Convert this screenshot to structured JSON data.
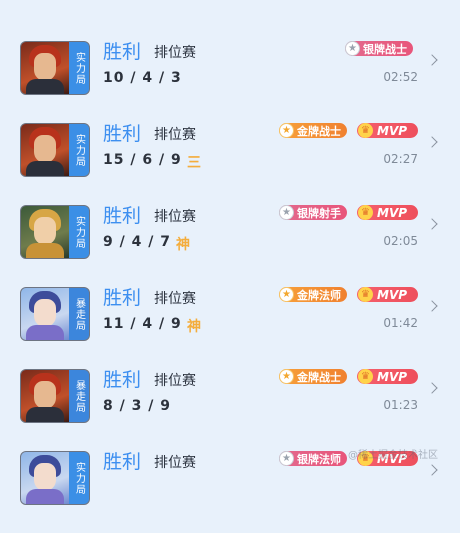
{
  "colors": {
    "result_win": "#3d8ff0",
    "tag_ranked": "#3b8fe6",
    "tag_rush": "#3c86dc",
    "badge_gold": "#f39a36",
    "badge_silver": "#e8587c",
    "mvp": "#f25a66",
    "honor_text": "#f4ad3c"
  },
  "matches": [
    {
      "result": "胜利",
      "match_type": "排位赛",
      "kda": "10 / 4 / 3",
      "honor": "",
      "badge": "银牌战士",
      "badge_tier": "silver",
      "mvp": "",
      "time": "02:52",
      "mode": "实力局",
      "hero_icon": "red-hair-warrior-portrait"
    },
    {
      "result": "胜利",
      "match_type": "排位赛",
      "kda": "15 / 6 / 9",
      "honor": "三",
      "badge": "金牌战士",
      "badge_tier": "gold",
      "mvp": "MVP",
      "time": "02:27",
      "mode": "实力局",
      "hero_icon": "red-hair-warrior-portrait"
    },
    {
      "result": "胜利",
      "match_type": "排位赛",
      "kda": "9 / 4 / 7",
      "honor": "神",
      "badge": "银牌射手",
      "badge_tier": "silver",
      "mvp": "MVP",
      "time": "02:05",
      "mode": "实力局",
      "hero_icon": "golden-archer-portrait"
    },
    {
      "result": "胜利",
      "match_type": "排位赛",
      "kda": "11 / 4 / 9",
      "honor": "神",
      "badge": "金牌法师",
      "badge_tier": "gold",
      "mvp": "MVP",
      "time": "01:42",
      "mode": "暴走局",
      "hero_icon": "blue-hair-mage-portrait"
    },
    {
      "result": "胜利",
      "match_type": "排位赛",
      "kda": "8 / 3 / 9",
      "honor": "",
      "badge": "金牌战士",
      "badge_tier": "gold",
      "mvp": "MVP",
      "time": "01:23",
      "mode": "暴走局",
      "hero_icon": "red-hair-warrior-portrait"
    },
    {
      "result": "胜利",
      "match_type": "排位赛",
      "kda": "",
      "honor": "",
      "badge": "银牌法师",
      "badge_tier": "silver",
      "mvp": "MVP",
      "time": "",
      "mode": "实力局",
      "hero_icon": "blue-hair-mage-portrait"
    }
  ],
  "watermark": "@稀土掘金技术社区"
}
